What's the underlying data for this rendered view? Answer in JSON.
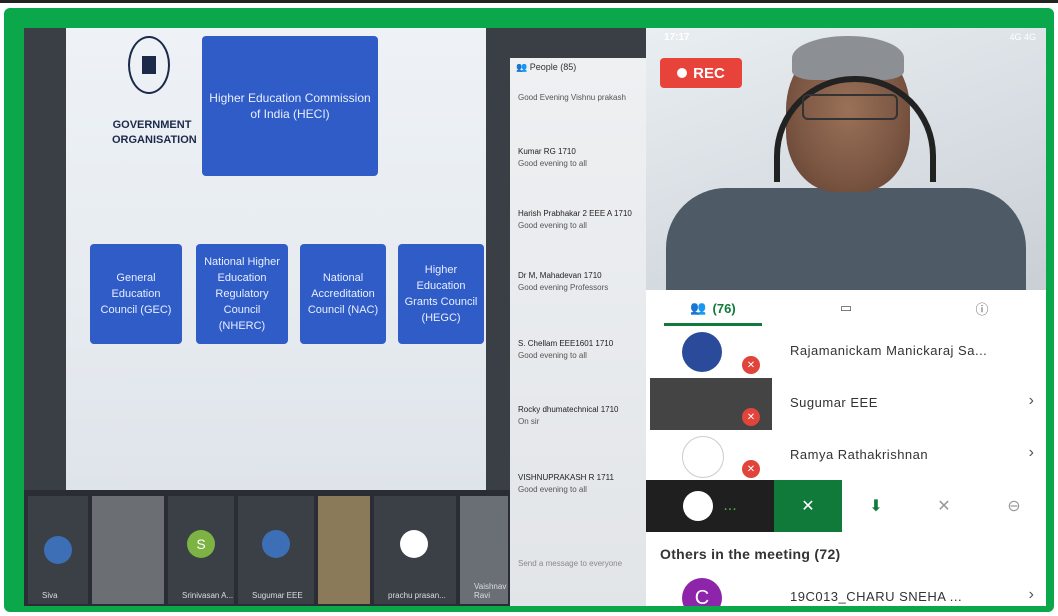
{
  "slide": {
    "gov_line1": "GOVERNMENT",
    "gov_line2": "ORGANISATION",
    "heci": "Higher Education Commission of India (HECI)",
    "boxes": [
      "General Education Council (GEC)",
      "National Higher Education Regulatory Council (NHERC)",
      "National Accreditation Council (NAC)",
      "Higher Education Grants Council (HEGC)"
    ]
  },
  "laptop_chat": {
    "header": "People (85)",
    "messages": [
      {
        "name": "",
        "text": "Good Evening Vishnu prakash"
      },
      {
        "name": "Kumar RG 1710",
        "text": "Good evening to all"
      },
      {
        "name": "Harish Prabhakar 2 EEE A 1710",
        "text": "Good evening to all"
      },
      {
        "name": "Dr M, Mahadevan 1710",
        "text": "Good evening Professors"
      },
      {
        "name": "S. Chellam EEE1601 1710",
        "text": "Good evening to all"
      },
      {
        "name": "Rocky dhumatechnical 1710",
        "text": "On sir"
      },
      {
        "name": "VISHNUPRAKASH R 1711",
        "text": "Good evening to all"
      }
    ],
    "input_placeholder": "Send a message to everyone"
  },
  "tiles": [
    {
      "label": "Siva",
      "letter": ""
    },
    {
      "label": "",
      "letter": ""
    },
    {
      "label": "Srinivasan A...",
      "letter": "S"
    },
    {
      "label": "Sugumar EEE",
      "letter": ""
    },
    {
      "label": "",
      "letter": ""
    },
    {
      "label": "prachu prasan...",
      "letter": ""
    },
    {
      "label": "Vaishnav Ravi",
      "letter": ""
    }
  ],
  "phone": {
    "time": "17:17",
    "status_right": "4G 4G",
    "rec_label": "REC",
    "people_count": "(76)",
    "participants": [
      {
        "name": "Rajamanickam Manickaraj Sa...",
        "chevron": ""
      },
      {
        "name": "Sugumar EEE",
        "chevron": "›"
      },
      {
        "name": "Ramya Rathakrishnan",
        "chevron": "›"
      }
    ],
    "others_label": "Others in the meeting (72)",
    "others": [
      {
        "initial": "C",
        "name": "19C013_CHARU SNEHA ...",
        "chevron": "›"
      }
    ],
    "control_dots": "..."
  },
  "colors": {
    "frame": "#0aa84a",
    "accent": "#0f7a3a",
    "rec": "#e8433a",
    "slide_box": "#2f5cc6"
  }
}
